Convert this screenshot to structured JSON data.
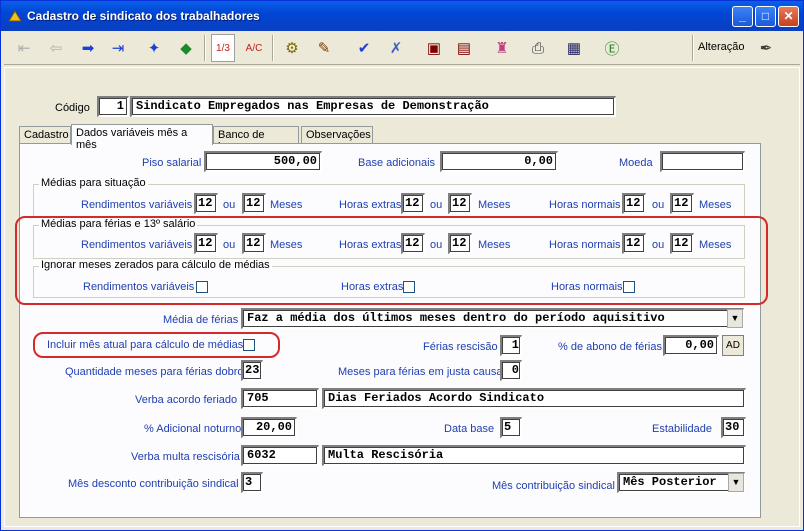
{
  "window": {
    "title": "Cadastro de sindicato dos trabalhadores"
  },
  "toolbar": {
    "mode_label": "Alteração"
  },
  "header": {
    "codigo_label": "Código",
    "codigo_value": "1",
    "nome_value": "Sindicato Empregados nas Empresas de Demonstração"
  },
  "tabs": [
    "Cadastro",
    "Dados variáveis mês a mês",
    "Banco de horas",
    "Observações"
  ],
  "form": {
    "piso_label": "Piso salarial",
    "piso_value": "500,00",
    "base_label": "Base adicionais",
    "base_value": "0,00",
    "moeda_label": "Moeda",
    "moeda_value": "",
    "g1_title": "Médias para situação",
    "g2_title": "Médias para férias e 13º salário",
    "g3_title": "Ignorar meses zerados para cálculo de médias",
    "rend_label": "Rendimentos variáveis",
    "hextra_label": "Horas extras",
    "hnormal_label": "Horas normais",
    "ou": "ou",
    "meses": "Meses",
    "v12": "12",
    "g3_rend": "Rendimentos variáveis",
    "g3_hextra": "Horas extras",
    "g3_hnormal": "Horas normais",
    "media_ferias_label": "Média de férias",
    "media_ferias_value": "Faz a média dos últimos meses dentro do período aquisitivo",
    "incluir_label": "Incluir mês atual para cálculo de médias",
    "ferias_resc_label": "Férias rescisão",
    "ferias_resc_value": "1",
    "abono_label": "% de abono de férias",
    "abono_value": "0,00",
    "ad_button": "AD",
    "qtd_dobro_label": "Quantidade meses para férias dobro",
    "qtd_dobro_value": "23",
    "justa_causa_label": "Meses para férias em justa causa",
    "justa_causa_value": "0",
    "verba_feriado_label": "Verba acordo feriado",
    "verba_feriado_code": "705",
    "verba_feriado_desc": "Dias Feriados Acordo Sindicato",
    "adic_noturno_label": "% Adicional noturno",
    "adic_noturno_value": "20,00",
    "data_base_label": "Data base",
    "data_base_value": "5",
    "estabilidade_label": "Estabilidade",
    "estabilidade_value": "30",
    "verba_multa_label": "Verba multa rescisória",
    "verba_multa_code": "6032",
    "verba_multa_desc": "Multa Rescisória",
    "mes_desc_label": "Mês desconto contribuição sindical",
    "mes_desc_value": "3",
    "mes_contrib_label": "Mês contribuição sindical",
    "mes_contrib_value": "Mês Posterior"
  }
}
